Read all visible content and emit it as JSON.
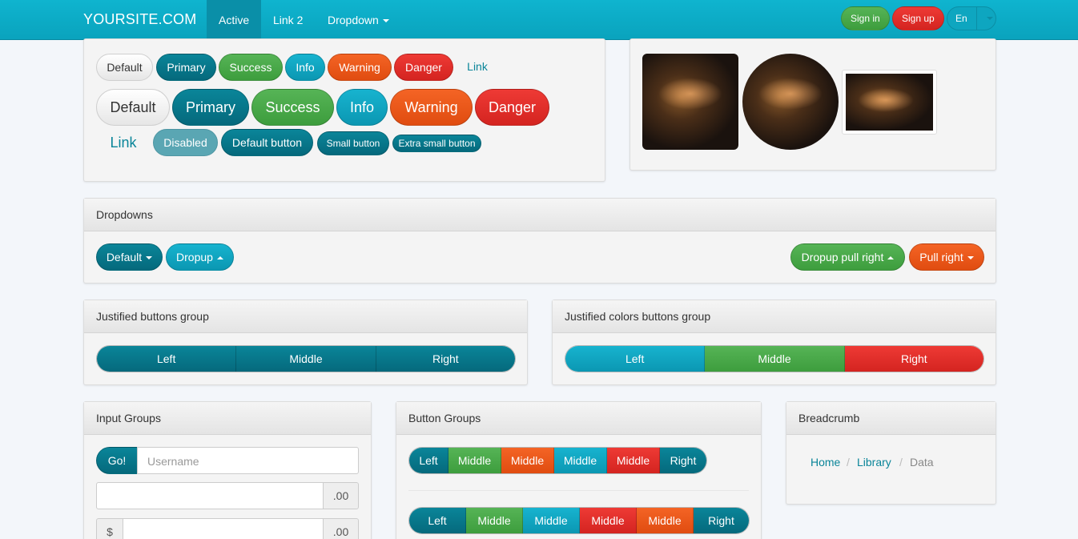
{
  "navbar": {
    "brand": "YOURSITE.COM",
    "items": [
      {
        "label": "Active",
        "active": true
      },
      {
        "label": "Link 2"
      },
      {
        "label": "Dropdown",
        "caret": true
      }
    ],
    "sign_in": "Sign in",
    "sign_up": "Sign up",
    "language": "En"
  },
  "buttons_panel": {
    "row1": [
      "Default",
      "Primary",
      "Success",
      "Info",
      "Warning",
      "Danger",
      "Link"
    ],
    "row2": [
      "Default",
      "Primary",
      "Success",
      "Info",
      "Warning",
      "Danger"
    ],
    "row3": {
      "link": "Link",
      "disabled": "Disabled",
      "default_button": "Default button",
      "small_button": "Small button",
      "xs_button": "Extra small button"
    }
  },
  "dropdowns": {
    "title": "Dropdowns",
    "default": "Default",
    "dropup": "Dropup",
    "dropup_pull_right": "Dropup pull right",
    "pull_right": "Pull right"
  },
  "justified": {
    "title": "Justified buttons group",
    "buttons": [
      "Left",
      "Middle",
      "Right"
    ]
  },
  "justified_colors": {
    "title": "Justified colors buttons group",
    "buttons": [
      "Left",
      "Middle",
      "Right"
    ]
  },
  "input_groups": {
    "title": "Input Groups",
    "go": "Go!",
    "username_placeholder": "Username",
    "cents_addon": ".00",
    "dollar_addon": "$",
    "cents_addon2": ".00"
  },
  "button_groups": {
    "title": "Button Groups",
    "row1": [
      "Left",
      "Middle",
      "Middle",
      "Middle",
      "Middle",
      "Right"
    ],
    "row2": [
      "Left",
      "Middle",
      "Middle",
      "Middle",
      "Middle",
      "Right"
    ]
  },
  "breadcrumb": {
    "title": "Breadcrumb",
    "items": [
      "Home",
      "Library",
      "Data"
    ],
    "separator": "/"
  },
  "colors": {
    "primary": "#05697c",
    "success": "#3d9d3d",
    "info": "#0b97b2",
    "warning": "#e04c10",
    "danger": "#d42420",
    "navbar": "#0aa3bd"
  }
}
